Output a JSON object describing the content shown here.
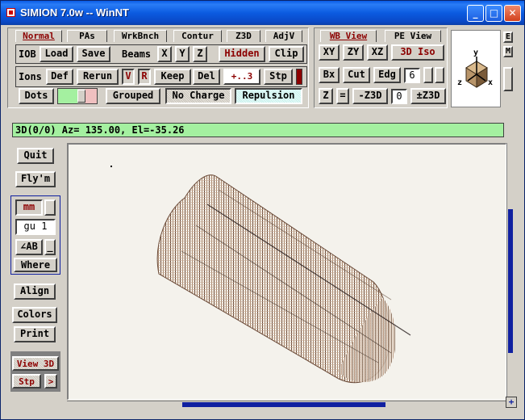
{
  "window": {
    "title": "SIMION 7.0w -- WinNT",
    "min_glyph": "_",
    "max_glyph": "□",
    "close_glyph": "✕"
  },
  "tabs_left": [
    "Normal",
    "PAs",
    "WrkBnch",
    "Contur",
    "Z3D",
    "AdjV"
  ],
  "tabs_right": [
    "WB View",
    "PE View"
  ],
  "row1": {
    "iob_label": "IOB",
    "load": "Load",
    "save": "Save",
    "beams_label": "Beams",
    "beam_x": "X",
    "beam_y": "Y",
    "beam_z": "Z",
    "hidden": "Hidden",
    "clip": "Clip"
  },
  "row2": {
    "ions_label": "Ions",
    "def": "Def",
    "rerun": "Rerun",
    "v": "V",
    "r": "R",
    "keep": "Keep",
    "del": "Del",
    "time_value": "+..3",
    "stp": "Stp"
  },
  "row3": {
    "dots": "Dots",
    "grouped": "Grouped",
    "no_charge": "No Charge",
    "repulsion": "Repulsion"
  },
  "view_controls": {
    "xy": "XY",
    "zy": "ZY",
    "xz": "XZ",
    "iso": "3D Iso",
    "bx": "Bx",
    "cut": "Cut",
    "edg": "Edg",
    "edg_value": "6",
    "z": "Z",
    "eq": "=",
    "minus_z3d": "-Z3D",
    "z3d_value": "0",
    "pm_z3d": "±Z3D"
  },
  "axis_labels": {
    "y": "y",
    "z": "z",
    "x": "x"
  },
  "side_tabs": [
    "E",
    "M"
  ],
  "status_text": "3D(0/0) Az= 135.00, El=-35.26",
  "left_panel": {
    "quit": "Quit",
    "flym": "Fly'm",
    "units": "mm",
    "grid_unit": "gu  1",
    "angle": "∠AB",
    "angle_sub": "_",
    "where": "Where",
    "align": "Align",
    "colors": "Colors",
    "print": "Print",
    "view_3d": "View 3D",
    "stp": "Stp",
    "arrow": ">"
  },
  "scroll": {
    "corner": "+"
  }
}
